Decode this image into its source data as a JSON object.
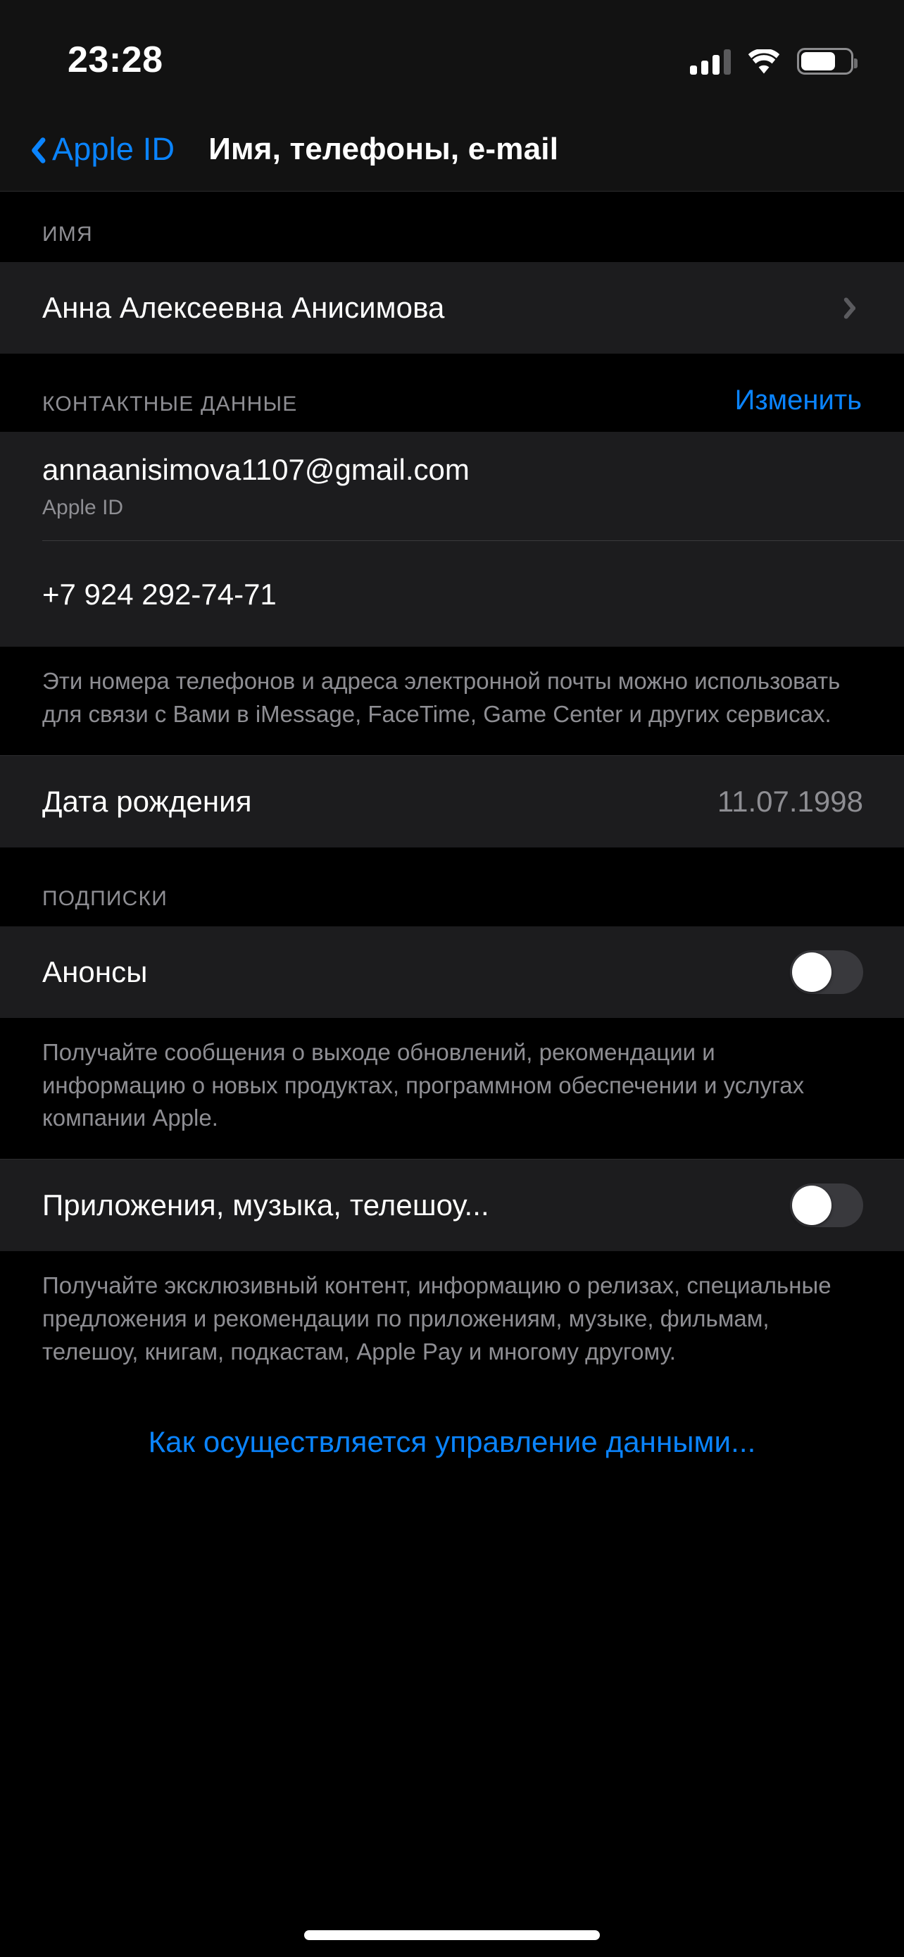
{
  "status_bar": {
    "time": "23:28",
    "cellular_icon": "cellular-signal-icon",
    "cellular_bars_filled": 3,
    "cellular_bars_total": 4,
    "wifi_icon": "wifi-icon",
    "battery_icon": "battery-icon",
    "battery_level_percent": 70
  },
  "nav": {
    "back_icon": "chevron-left-icon",
    "back_label": "Apple ID",
    "title": "Имя, телефоны, e-mail"
  },
  "sections": {
    "name": {
      "header": "ИМЯ",
      "row_label": "Анна Алексеевна Анисимова",
      "disclosure_icon": "chevron-right-icon"
    },
    "contact": {
      "header": "КОНТАКТНЫЕ ДАННЫЕ",
      "action": "Изменить",
      "email": "annaanisimova1107@gmail.com",
      "email_subtitle": "Apple ID",
      "phone": "+7 924 292-74-71",
      "footnote": "Эти номера телефонов и адреса электронной почты можно использовать для связи с Вами в iMessage, FaceTime, Game Center и других сервисах."
    },
    "birthday": {
      "label": "Дата рождения",
      "value": "11.07.1998"
    },
    "subscriptions": {
      "header": "ПОДПИСКИ",
      "announcements": {
        "label": "Анонсы",
        "toggle_state": "off",
        "footnote": "Получайте сообщения о выходе обновлений, рекомендации и информацию о новых продуктах, программном обеспечении и услугах компании Apple."
      },
      "apps_music_tv": {
        "label": "Приложения, музыка, телешоу...",
        "toggle_state": "off",
        "footnote": "Получайте эксклюзивный контент, информацию о релизах, специальные предложения и рекомендации по приложениям, музыке, фильмам, телешоу, книгам, подкастам, Apple Pay и многому другому."
      },
      "data_link": "Как осуществляется управление данными..."
    }
  },
  "colors": {
    "accent_blue": "#0a84ff",
    "background": "#000000",
    "group_background": "#1c1c1e",
    "secondary_text": "#8e8e93",
    "toggle_off_track": "#39393d"
  }
}
